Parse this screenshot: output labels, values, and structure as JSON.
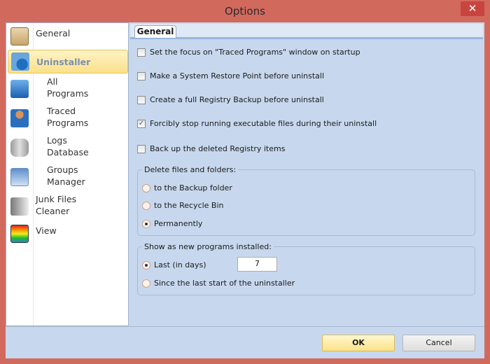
{
  "window": {
    "title": "Options",
    "close_icon": "close-icon"
  },
  "sidebar": {
    "items": [
      {
        "label": "General",
        "icon": "clipboard-check-icon"
      },
      {
        "label": "Uninstaller",
        "icon": "uninstaller-icon"
      },
      {
        "label": "All\nPrograms",
        "icon": "programs-icon"
      },
      {
        "label": "Traced\nPrograms",
        "icon": "user-icon"
      },
      {
        "label": "Logs\nDatabase",
        "icon": "database-icon"
      },
      {
        "label": "Groups\nManager",
        "icon": "groups-icon"
      },
      {
        "label": "Junk Files\nCleaner",
        "icon": "cleaner-icon"
      },
      {
        "label": "View",
        "icon": "view-grid-icon"
      }
    ]
  },
  "tab": {
    "label": "General"
  },
  "options": [
    {
      "label": "Set the focus on \"Traced Programs\" window on startup",
      "checked": false
    },
    {
      "label": "Make a System Restore Point before uninstall",
      "checked": false
    },
    {
      "label": "Create a full Registry Backup before uninstall",
      "checked": false
    },
    {
      "label": "Forcibly stop running executable files during their uninstall",
      "checked": true
    },
    {
      "label": "Back up the deleted Registry items",
      "checked": false
    }
  ],
  "delete_group": {
    "title": "Delete files and folders:",
    "options": [
      "to the Backup folder",
      "to the Recycle Bin",
      "Permanently"
    ],
    "selected": 2
  },
  "show_group": {
    "title": "Show as new programs installed:",
    "options": [
      "Last (in days)",
      "Since the last start of the uninstaller"
    ],
    "selected": 0,
    "days": "7"
  },
  "buttons": {
    "ok": "OK",
    "cancel": "Cancel"
  }
}
